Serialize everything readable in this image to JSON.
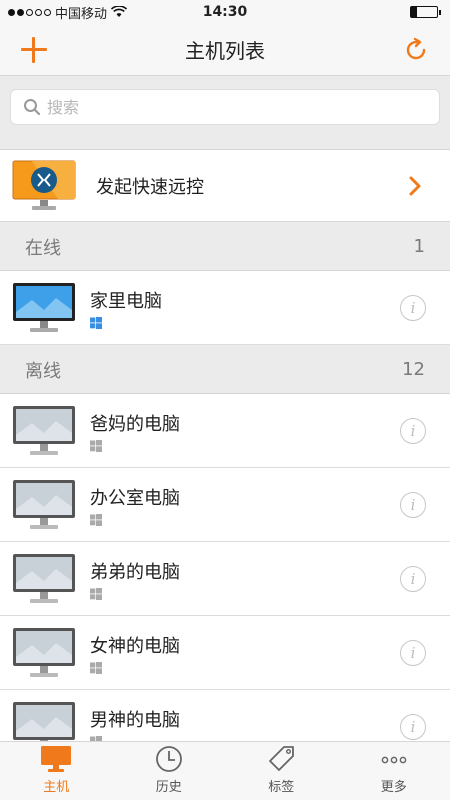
{
  "status_bar": {
    "carrier": "中国移动",
    "time": "14:30"
  },
  "nav": {
    "title": "主机列表",
    "add_icon": "plus-icon",
    "refresh_icon": "refresh-icon"
  },
  "search": {
    "placeholder": "搜索"
  },
  "quick_remote": {
    "label": "发起快速远控"
  },
  "online": {
    "title": "在线",
    "count": "1"
  },
  "offline": {
    "title": "离线",
    "count": "12"
  },
  "online_devices": [
    {
      "name": "家里电脑",
      "os": "windows"
    }
  ],
  "offline_devices": [
    {
      "name": "爸妈的电脑",
      "os": "windows"
    },
    {
      "name": "办公室电脑",
      "os": "windows"
    },
    {
      "name": "弟弟的电脑",
      "os": "windows"
    },
    {
      "name": "女神的电脑",
      "os": "windows"
    },
    {
      "name": "男神的电脑",
      "os": "windows"
    }
  ],
  "tabs": [
    {
      "label": "主机",
      "icon": "monitor-icon",
      "active": true
    },
    {
      "label": "历史",
      "icon": "clock-icon",
      "active": false
    },
    {
      "label": "标签",
      "icon": "tag-icon",
      "active": false
    },
    {
      "label": "更多",
      "icon": "more-icon",
      "active": false
    }
  ],
  "colors": {
    "accent": "#f07a1b",
    "online_screen": "#3fa0ea",
    "offline_screen": "#c9d1d8"
  }
}
